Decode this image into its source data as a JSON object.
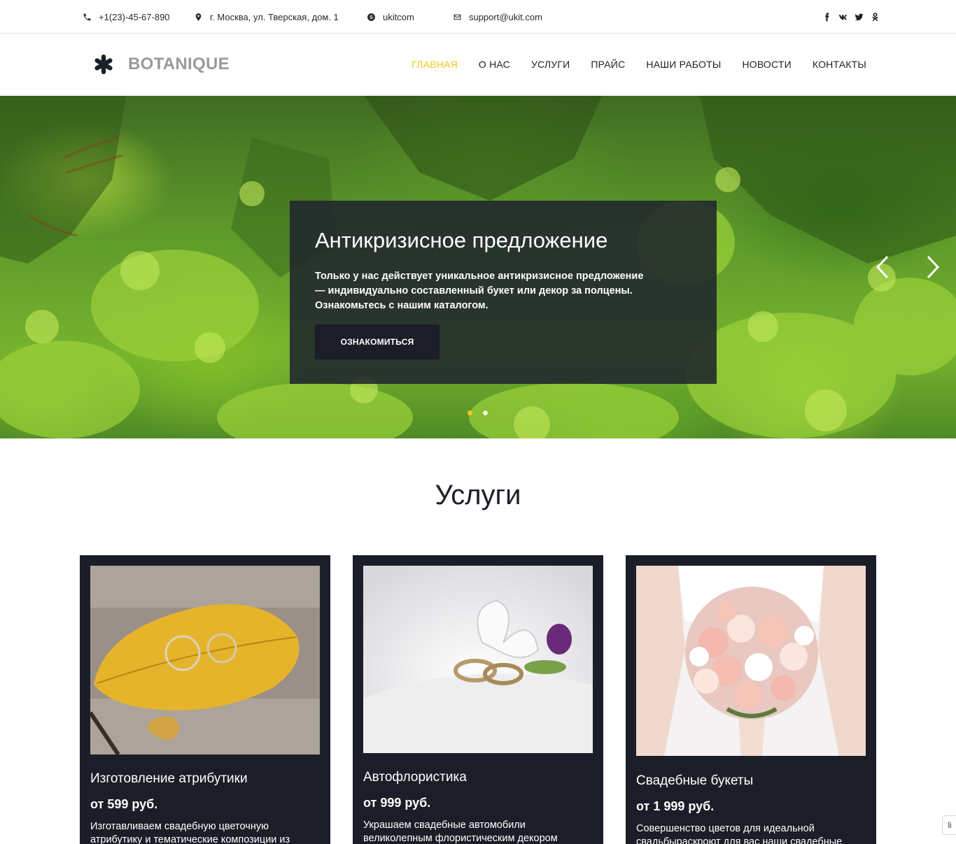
{
  "topbar": {
    "phone": "+1(23)-45-67-890",
    "address": "г. Москва, ул. Тверская, дом. 1",
    "skype": "ukitcom",
    "email": "support@ukit.com",
    "socials": [
      "facebook-icon",
      "vk-icon",
      "twitter-icon",
      "odnoklassniki-icon"
    ]
  },
  "header": {
    "logo_text": "BOTANIQUE",
    "nav": [
      "ГЛАВНАЯ",
      "О НАС",
      "УСЛУГИ",
      "ПРАЙС",
      "НАШИ РАБОТЫ",
      "НОВОСТИ",
      "КОНТАКТЫ"
    ],
    "active_index": 0,
    "accent_color": "#f5c518"
  },
  "hero": {
    "title": "Антикризисное предложение",
    "text": "Только у нас действует уникальное антикризисное предложение — индивидуально составленный букет или декор за полцены. Ознакомьтесь с нашим каталогом.",
    "button": "ОЗНАКОМИТЬСЯ",
    "slides": 2,
    "active_slide": 1
  },
  "services": {
    "title": "Услуги",
    "cards": [
      {
        "title": "Изготовление атрибутики",
        "price": "от 599 руб.",
        "desc": "Изготавливаем свадебную цветочную атрибутику и тематические композиции из"
      },
      {
        "title": "Автофлористика",
        "price": "от 999 руб.",
        "desc": "Украшаем свадебные автомобили великолепным флористическим декором"
      },
      {
        "title": "Свадебные букеты",
        "price": "от 1 999 руб.",
        "desc": "Совершенство цветов для идеальной свадьбыраскроют для вас наши свадебные"
      }
    ]
  },
  "side_tab": "li",
  "colors": {
    "dark": "#1b1e28",
    "text": "#1c1f2a",
    "logo_gray": "#9a9a9a"
  }
}
